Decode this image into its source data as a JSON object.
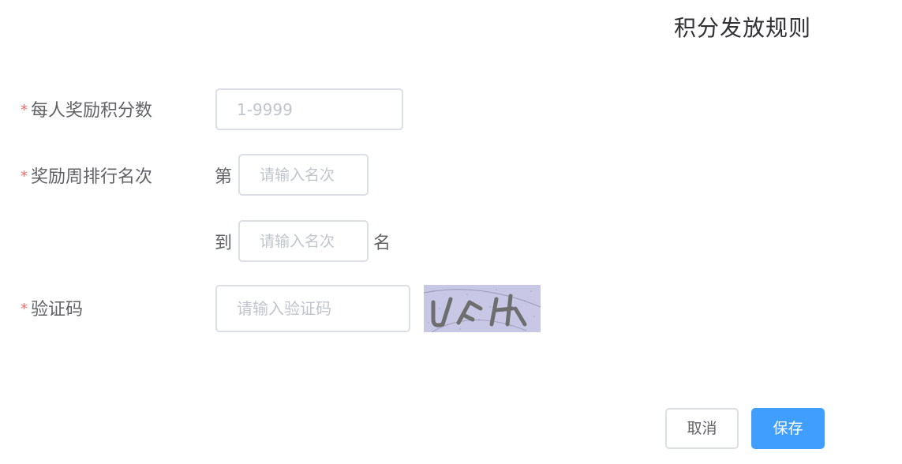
{
  "dialog": {
    "title": "积分发放规则"
  },
  "form": {
    "points_per_person": {
      "label": "每人奖励积分数",
      "placeholder": "1-9999",
      "value": ""
    },
    "rank_range": {
      "label": "奖励周排行名次",
      "from_prefix": "第",
      "from_placeholder": "请输入名次",
      "to_prefix": "到",
      "to_placeholder": "请输入名次",
      "to_suffix": "名"
    },
    "captcha": {
      "label": "验证码",
      "placeholder": "请输入验证码",
      "image_text": "UFH"
    },
    "required_mark": "*"
  },
  "footer": {
    "cancel_label": "取消",
    "save_label": "保存"
  },
  "colors": {
    "primary": "#409eff",
    "required": "#f56c6c",
    "border": "#dcdfe6",
    "placeholder": "#c0c4cc",
    "captcha_bg": "#c8c8e6"
  }
}
